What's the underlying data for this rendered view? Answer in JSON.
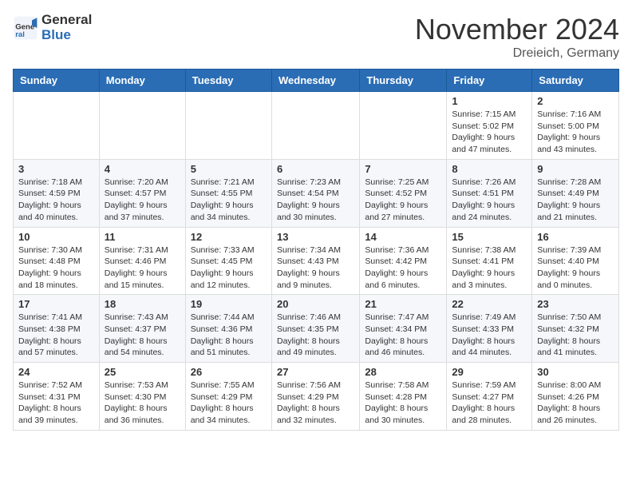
{
  "header": {
    "logo": {
      "text_general": "General",
      "text_blue": "Blue"
    },
    "title": "November 2024",
    "location": "Dreieich, Germany"
  },
  "weekdays": [
    "Sunday",
    "Monday",
    "Tuesday",
    "Wednesday",
    "Thursday",
    "Friday",
    "Saturday"
  ],
  "weeks": [
    [
      {
        "day": "",
        "info": ""
      },
      {
        "day": "",
        "info": ""
      },
      {
        "day": "",
        "info": ""
      },
      {
        "day": "",
        "info": ""
      },
      {
        "day": "",
        "info": ""
      },
      {
        "day": "1",
        "info": "Sunrise: 7:15 AM\nSunset: 5:02 PM\nDaylight: 9 hours and 47 minutes."
      },
      {
        "day": "2",
        "info": "Sunrise: 7:16 AM\nSunset: 5:00 PM\nDaylight: 9 hours and 43 minutes."
      }
    ],
    [
      {
        "day": "3",
        "info": "Sunrise: 7:18 AM\nSunset: 4:59 PM\nDaylight: 9 hours and 40 minutes."
      },
      {
        "day": "4",
        "info": "Sunrise: 7:20 AM\nSunset: 4:57 PM\nDaylight: 9 hours and 37 minutes."
      },
      {
        "day": "5",
        "info": "Sunrise: 7:21 AM\nSunset: 4:55 PM\nDaylight: 9 hours and 34 minutes."
      },
      {
        "day": "6",
        "info": "Sunrise: 7:23 AM\nSunset: 4:54 PM\nDaylight: 9 hours and 30 minutes."
      },
      {
        "day": "7",
        "info": "Sunrise: 7:25 AM\nSunset: 4:52 PM\nDaylight: 9 hours and 27 minutes."
      },
      {
        "day": "8",
        "info": "Sunrise: 7:26 AM\nSunset: 4:51 PM\nDaylight: 9 hours and 24 minutes."
      },
      {
        "day": "9",
        "info": "Sunrise: 7:28 AM\nSunset: 4:49 PM\nDaylight: 9 hours and 21 minutes."
      }
    ],
    [
      {
        "day": "10",
        "info": "Sunrise: 7:30 AM\nSunset: 4:48 PM\nDaylight: 9 hours and 18 minutes."
      },
      {
        "day": "11",
        "info": "Sunrise: 7:31 AM\nSunset: 4:46 PM\nDaylight: 9 hours and 15 minutes."
      },
      {
        "day": "12",
        "info": "Sunrise: 7:33 AM\nSunset: 4:45 PM\nDaylight: 9 hours and 12 minutes."
      },
      {
        "day": "13",
        "info": "Sunrise: 7:34 AM\nSunset: 4:43 PM\nDaylight: 9 hours and 9 minutes."
      },
      {
        "day": "14",
        "info": "Sunrise: 7:36 AM\nSunset: 4:42 PM\nDaylight: 9 hours and 6 minutes."
      },
      {
        "day": "15",
        "info": "Sunrise: 7:38 AM\nSunset: 4:41 PM\nDaylight: 9 hours and 3 minutes."
      },
      {
        "day": "16",
        "info": "Sunrise: 7:39 AM\nSunset: 4:40 PM\nDaylight: 9 hours and 0 minutes."
      }
    ],
    [
      {
        "day": "17",
        "info": "Sunrise: 7:41 AM\nSunset: 4:38 PM\nDaylight: 8 hours and 57 minutes."
      },
      {
        "day": "18",
        "info": "Sunrise: 7:43 AM\nSunset: 4:37 PM\nDaylight: 8 hours and 54 minutes."
      },
      {
        "day": "19",
        "info": "Sunrise: 7:44 AM\nSunset: 4:36 PM\nDaylight: 8 hours and 51 minutes."
      },
      {
        "day": "20",
        "info": "Sunrise: 7:46 AM\nSunset: 4:35 PM\nDaylight: 8 hours and 49 minutes."
      },
      {
        "day": "21",
        "info": "Sunrise: 7:47 AM\nSunset: 4:34 PM\nDaylight: 8 hours and 46 minutes."
      },
      {
        "day": "22",
        "info": "Sunrise: 7:49 AM\nSunset: 4:33 PM\nDaylight: 8 hours and 44 minutes."
      },
      {
        "day": "23",
        "info": "Sunrise: 7:50 AM\nSunset: 4:32 PM\nDaylight: 8 hours and 41 minutes."
      }
    ],
    [
      {
        "day": "24",
        "info": "Sunrise: 7:52 AM\nSunset: 4:31 PM\nDaylight: 8 hours and 39 minutes."
      },
      {
        "day": "25",
        "info": "Sunrise: 7:53 AM\nSunset: 4:30 PM\nDaylight: 8 hours and 36 minutes."
      },
      {
        "day": "26",
        "info": "Sunrise: 7:55 AM\nSunset: 4:29 PM\nDaylight: 8 hours and 34 minutes."
      },
      {
        "day": "27",
        "info": "Sunrise: 7:56 AM\nSunset: 4:29 PM\nDaylight: 8 hours and 32 minutes."
      },
      {
        "day": "28",
        "info": "Sunrise: 7:58 AM\nSunset: 4:28 PM\nDaylight: 8 hours and 30 minutes."
      },
      {
        "day": "29",
        "info": "Sunrise: 7:59 AM\nSunset: 4:27 PM\nDaylight: 8 hours and 28 minutes."
      },
      {
        "day": "30",
        "info": "Sunrise: 8:00 AM\nSunset: 4:26 PM\nDaylight: 8 hours and 26 minutes."
      }
    ]
  ]
}
